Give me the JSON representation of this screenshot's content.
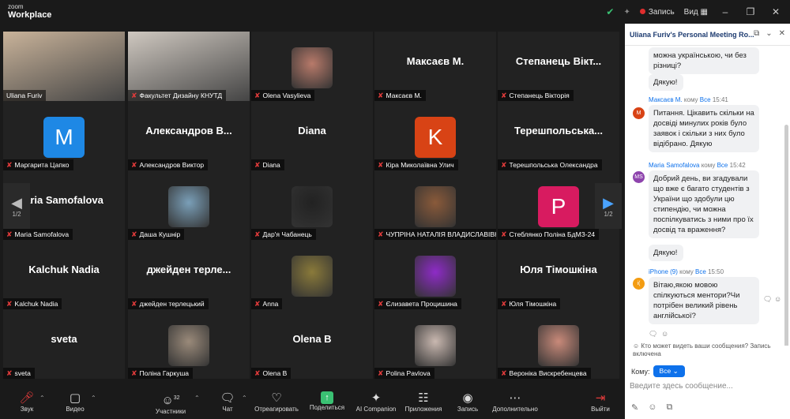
{
  "app": {
    "logo_top": "zoom",
    "logo_bottom": "Workplace"
  },
  "topbar": {
    "record_label": "Запись",
    "view_label": "Вид"
  },
  "tiles": [
    {
      "name": "Uliana Furiv",
      "type": "video",
      "color": "#c9b39a"
    },
    {
      "name": "Факультет Дизайну КНУТД",
      "type": "video",
      "color": "#cfc8c0"
    },
    {
      "name": "Olena Vasylieva",
      "type": "photo",
      "color": "#b87a6a"
    },
    {
      "name": "Максаєв М.",
      "type": "text",
      "big": "Максаєв М."
    },
    {
      "name": "Степанець Вікторія",
      "type": "text",
      "big": "Степанець Вікт..."
    },
    {
      "name": "Маргарита Цапко",
      "type": "avatar",
      "letter": "M",
      "color": "#1e88e5"
    },
    {
      "name": "Александров Виктор",
      "type": "text",
      "big": "Александров В..."
    },
    {
      "name": "Diana",
      "type": "text",
      "big": "Diana"
    },
    {
      "name": "Кіра Миколаївна Улич",
      "type": "avatar",
      "letter": "K",
      "color": "#d84315"
    },
    {
      "name": "Терешпольська Олександра",
      "type": "text",
      "big": "Терешпольська..."
    },
    {
      "name": "Maria Samofalova",
      "type": "text",
      "big": "aria Samofalova"
    },
    {
      "name": "Даша Кушнір",
      "type": "photo",
      "color": "#7a9fb8"
    },
    {
      "name": "Дар'я Чабанець",
      "type": "photo",
      "color": "#222222"
    },
    {
      "name": "ЧУПРІНА НАТАЛІЯ ВЛАДИСЛАВІВНА",
      "type": "photo",
      "color": "#8a5a3a"
    },
    {
      "name": "Стеблянко Поліна БдМЗ-24",
      "type": "avatar",
      "letter": "P",
      "color": "#d81b60"
    },
    {
      "name": "Kalchuk Nadia",
      "type": "text",
      "big": "Kalchuk Nadia"
    },
    {
      "name": "джейден терлецький",
      "type": "text",
      "big": "джейден терле..."
    },
    {
      "name": "Anna",
      "type": "photo",
      "color": "#8a7a3a"
    },
    {
      "name": "Єлизавета Процишина",
      "type": "photo",
      "color": "#8e2bc7"
    },
    {
      "name": "Юля Тімошкіна",
      "type": "text",
      "big": "Юля Тімошкіна"
    },
    {
      "name": "sveta",
      "type": "text",
      "big": "sveta"
    },
    {
      "name": "Поліна Гаркуша",
      "type": "photo",
      "color": "#9a8a7a"
    },
    {
      "name": "Olena B",
      "type": "text",
      "big": "Olena B"
    },
    {
      "name": "Polina Pavlova",
      "type": "photo",
      "color": "#c9b8b0"
    },
    {
      "name": "Вероніка Вискребенцева",
      "type": "photo",
      "color": "#c98a7a"
    }
  ],
  "pager": {
    "left": "1/2",
    "right": "1/2"
  },
  "toolbar": {
    "sound": "Звук",
    "video": "Видео",
    "participants": "Участники",
    "participants_count": "32",
    "chat": "Чат",
    "react": "Отреагировать",
    "share": "Поделиться",
    "ai": "AI Companion",
    "apps": "Приложения",
    "record": "Запись",
    "more": "Дополнительно",
    "leave": "Выйти"
  },
  "chat": {
    "title": "Uliana Furiv's Personal Meeting Ro...",
    "msg0": "можна українською, чи без різниці?",
    "msg1": "Дякую!",
    "m2_sender": "Максаєв М.",
    "m2_to_prefix": "кому",
    "m2_to": "Все",
    "m2_time": "15:41",
    "m2_initial": "M",
    "msg2": "Питання. Цікавить скільки на досвіді минулих років було заявок і скільки з них було відібрано. Дякую",
    "m3_sender": "Maria Samofalova",
    "m3_to_prefix": "кому",
    "m3_to": "Все",
    "m3_time": "15:42",
    "m3_initial": "MS",
    "msg3": "Добрий день, ви згадували що вже є багато студентів з України що здобули цю стипендію, чи можна поспілкуватись з ними про їх досвід та враження?",
    "msg4": "Дякую!",
    "m5_sender": "iPhone (9)",
    "m5_to_prefix": "кому",
    "m5_to": "Все",
    "m5_time": "15:50",
    "m5_initial": "i(",
    "msg5": "Вітаю,якою мовою спілкуються ментори?Чи потрібен великий рівень англійської?",
    "privacy": "Кто может видеть ваши сообщения? Запись включена",
    "to_label": "Кому:",
    "to_value": "Все",
    "placeholder": "Введите здесь сообщение..."
  }
}
